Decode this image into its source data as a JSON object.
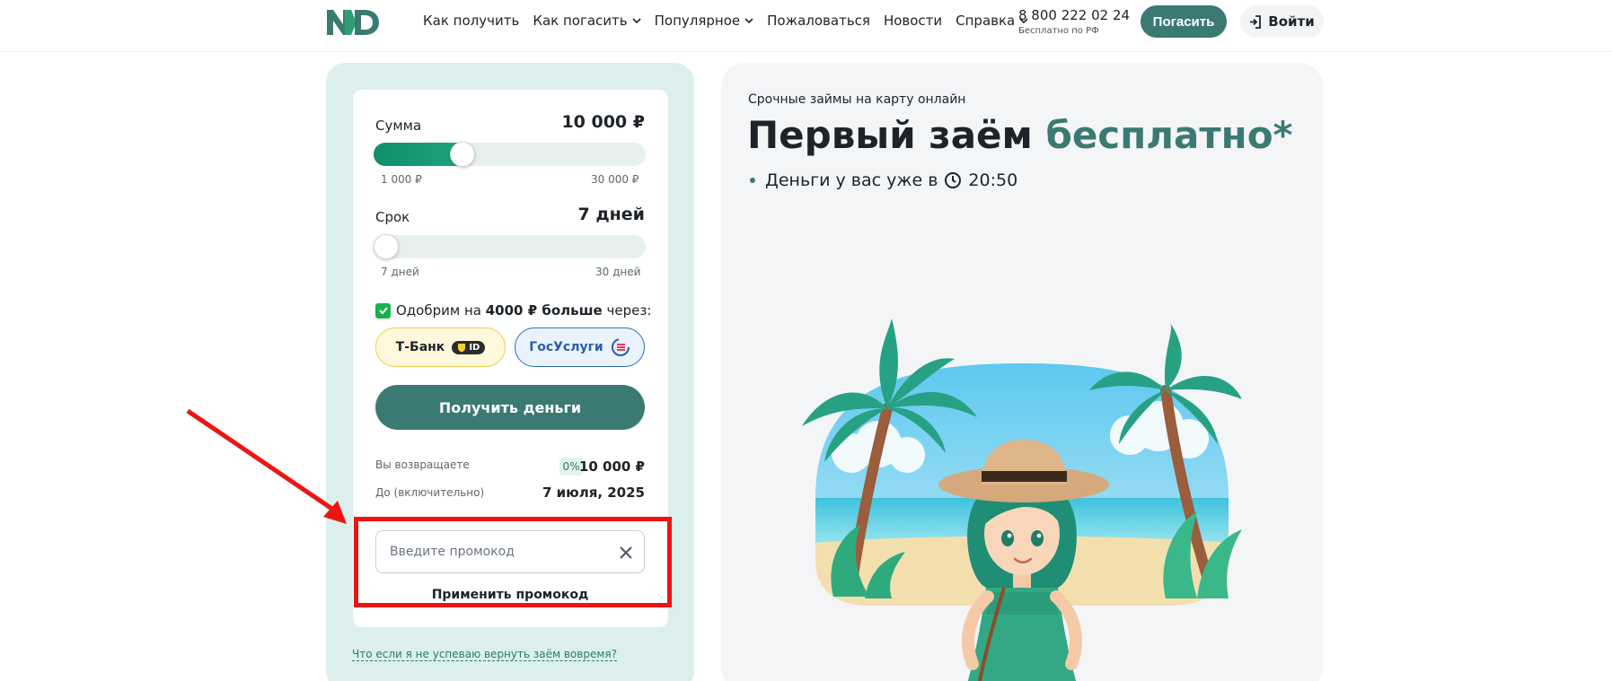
{
  "header": {
    "nav": [
      {
        "label": "Как получить",
        "has_dropdown": false
      },
      {
        "label": "Как погасить",
        "has_dropdown": true
      },
      {
        "label": "Популярное",
        "has_dropdown": true
      },
      {
        "label": "Пожаловаться",
        "has_dropdown": false
      },
      {
        "label": "Новости",
        "has_dropdown": false
      },
      {
        "label": "Справка",
        "has_dropdown": true
      }
    ],
    "phone": "8 800 222 02 24",
    "phone_note": "Бесплатно по РФ",
    "pay_label": "Погасить",
    "login_label": "Войти"
  },
  "calculator": {
    "amount_label": "Сумма",
    "amount_value": "10 000 ₽",
    "amount_min": "1 000 ₽",
    "amount_max": "30 000 ₽",
    "amount_level": 0.31,
    "term_label": "Срок",
    "term_value": "7 дней",
    "term_min": "7 дней",
    "term_max": "30 дней",
    "term_level": 0.0,
    "approve_prefix": "Одобрим на",
    "approve_bold": "4000 ₽ больше",
    "approve_suffix": "через:",
    "tbank_label": "Т-Банк",
    "tbank_badge": "ID",
    "gosuslugi_label": "ГосУслуги",
    "get_money_label": "Получить деньги",
    "return_label": "Вы возвращаете",
    "return_percent": "0%",
    "return_value": "10 000 ₽",
    "until_label": "До (включительно)",
    "until_value": "7 июля, 2025",
    "promo_placeholder": "Введите промокод",
    "promo_apply_label": "Применить промокод",
    "late_link": "Что если я не успеваю вернуть заём вовремя?"
  },
  "hero": {
    "subtitle": "Срочные займы на карту онлайн",
    "title_plain": "Первый заём",
    "title_accent": "бесплатно*",
    "bullet_text": "Деньги у вас уже в",
    "bullet_time": "20:50"
  },
  "colors": {
    "brand": "#3b7a73",
    "highlight": "#ee1414",
    "slider_fill": "#0f8e6e"
  }
}
